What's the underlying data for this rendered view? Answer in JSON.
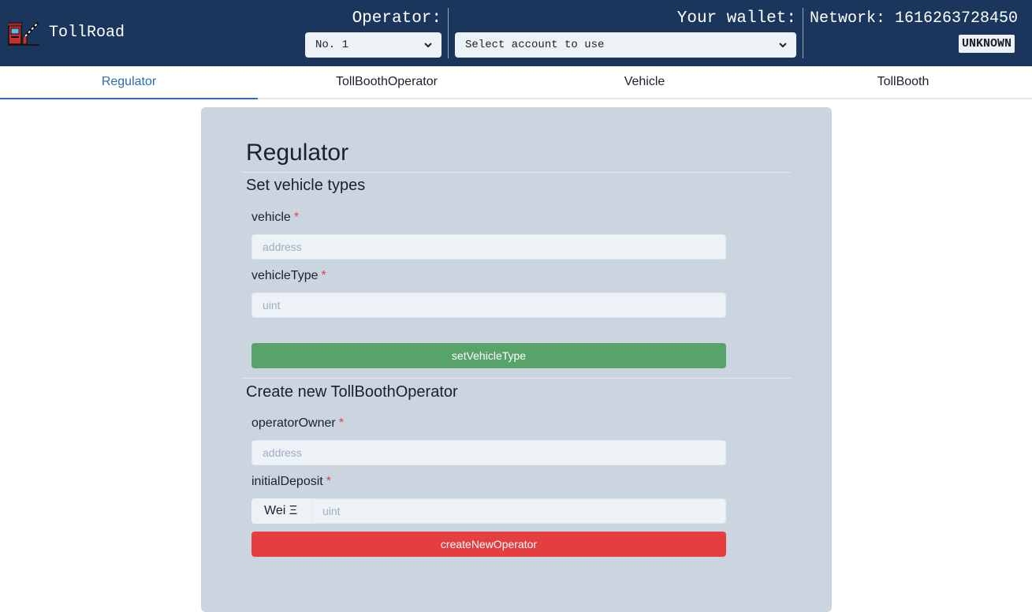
{
  "header": {
    "brand": "TollRoad",
    "operator_label": "Operator:",
    "operator_selected": "No. 1",
    "wallet_label": "Your wallet:",
    "wallet_placeholder": "Select account to use",
    "network_text": "Network: 1616263728450",
    "network_badge": "UNKNOWN"
  },
  "tabs": [
    {
      "label": "Regulator",
      "active": true
    },
    {
      "label": "TollBoothOperator",
      "active": false
    },
    {
      "label": "Vehicle",
      "active": false
    },
    {
      "label": "TollBooth",
      "active": false
    }
  ],
  "panel": {
    "title": "Regulator",
    "section1": {
      "title": "Set vehicle types",
      "vehicle_label": "vehicle",
      "vehicle_placeholder": "address",
      "vehicle_type_label": "vehicleType",
      "vehicle_type_placeholder": "uint",
      "button": "setVehicleType"
    },
    "section2": {
      "title": "Create new TollBoothOperator",
      "owner_label": "operatorOwner",
      "owner_placeholder": "address",
      "deposit_label": "initialDeposit",
      "deposit_unit": "Wei Ξ",
      "deposit_placeholder": "uint",
      "button": "createNewOperator"
    },
    "required_mark": "*"
  },
  "colors": {
    "header_bg": "#1b365d",
    "tab_active": "#2b6cb0",
    "panel_bg": "#cbd5e0",
    "button_green": "#58a36a",
    "button_red": "#e53e3e"
  }
}
